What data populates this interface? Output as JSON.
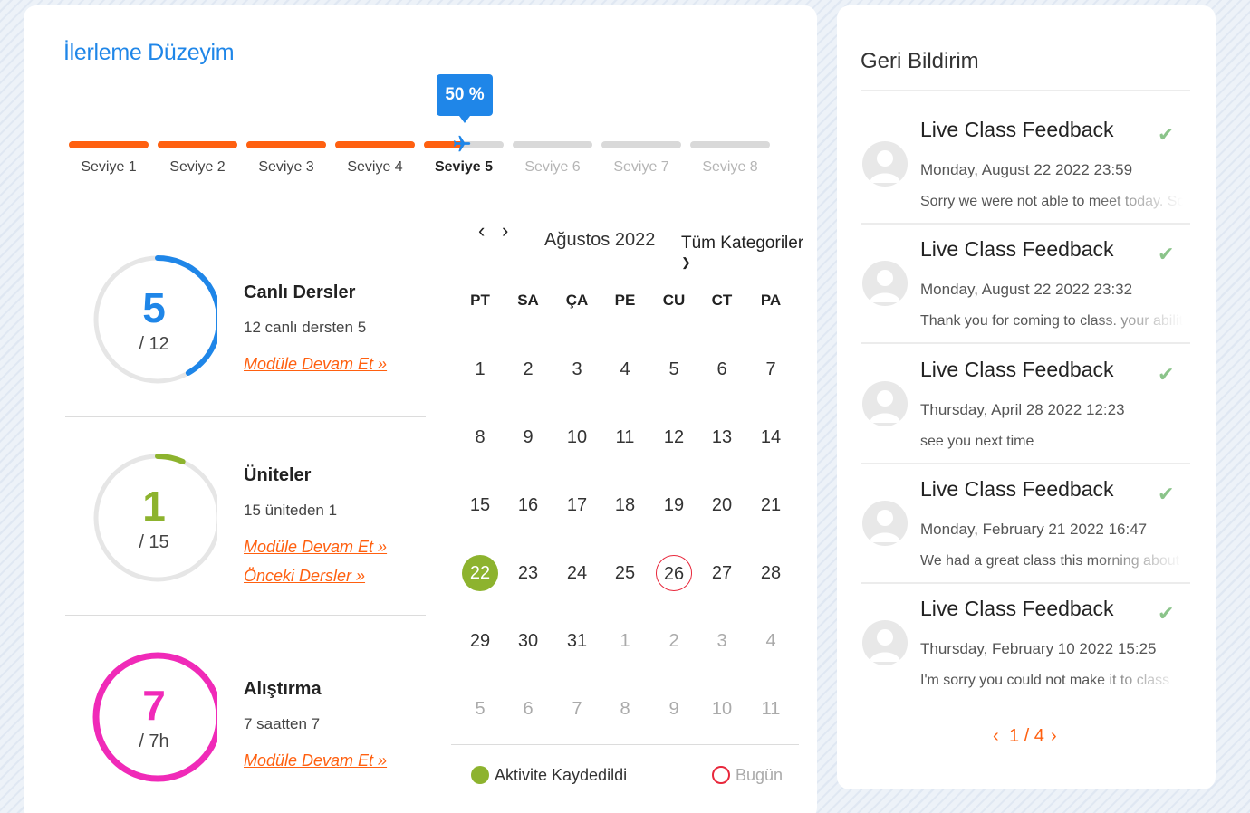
{
  "progress": {
    "title": "İlerleme Düzeyim",
    "percent_label": "50 %",
    "percent_value": 50,
    "current_level": 5,
    "levels": [
      "Seviye 1",
      "Seviye 2",
      "Seviye 3",
      "Seviye 4",
      "Seviye 5",
      "Seviye 6",
      "Seviye 7",
      "Seviye 8"
    ]
  },
  "stats": [
    {
      "number": "5",
      "total": "/ 12",
      "fraction": 0.4167,
      "color": "#1f86e8",
      "title": "Canlı Dersler",
      "desc": "12 canlı dersten 5",
      "links": [
        "Modüle Devam Et »"
      ]
    },
    {
      "number": "1",
      "total": "/ 15",
      "fraction": 0.0667,
      "color": "#8db32e",
      "title": "Üniteler",
      "desc": "15 üniteden 1",
      "links": [
        "Modüle Devam Et »",
        "Önceki Dersler »"
      ]
    },
    {
      "number": "7",
      "total": "/ 7h",
      "fraction": 1.0,
      "color": "#f02ab8",
      "title": "Alıştırma",
      "desc": "7 saatten 7",
      "links": [
        "Modüle Devam Et »"
      ]
    }
  ],
  "calendar": {
    "month": "Ağustos 2022",
    "prev": "‹",
    "next": "›",
    "category": "Tüm Kategoriler",
    "category_icon": "chevron-down",
    "weekdays": [
      "PT",
      "SA",
      "ÇA",
      "PE",
      "CU",
      "CT",
      "PA"
    ],
    "weeks": [
      [
        {
          "d": "1"
        },
        {
          "d": "2"
        },
        {
          "d": "3"
        },
        {
          "d": "4"
        },
        {
          "d": "5"
        },
        {
          "d": "6"
        },
        {
          "d": "7"
        }
      ],
      [
        {
          "d": "8"
        },
        {
          "d": "9"
        },
        {
          "d": "10"
        },
        {
          "d": "11"
        },
        {
          "d": "12"
        },
        {
          "d": "13"
        },
        {
          "d": "14"
        }
      ],
      [
        {
          "d": "15"
        },
        {
          "d": "16"
        },
        {
          "d": "17"
        },
        {
          "d": "18"
        },
        {
          "d": "19"
        },
        {
          "d": "20"
        },
        {
          "d": "21"
        }
      ],
      [
        {
          "d": "22",
          "activity": true
        },
        {
          "d": "23"
        },
        {
          "d": "24"
        },
        {
          "d": "25"
        },
        {
          "d": "26",
          "today": true
        },
        {
          "d": "27"
        },
        {
          "d": "28"
        }
      ],
      [
        {
          "d": "29"
        },
        {
          "d": "30"
        },
        {
          "d": "31"
        },
        {
          "d": "1",
          "other": true
        },
        {
          "d": "2",
          "other": true
        },
        {
          "d": "3",
          "other": true
        },
        {
          "d": "4",
          "other": true
        }
      ],
      [
        {
          "d": "5",
          "other": true
        },
        {
          "d": "6",
          "other": true
        },
        {
          "d": "7",
          "other": true
        },
        {
          "d": "8",
          "other": true
        },
        {
          "d": "9",
          "other": true
        },
        {
          "d": "10",
          "other": true
        },
        {
          "d": "11",
          "other": true
        }
      ]
    ],
    "legend_activity": "Aktivite Kaydedildi",
    "legend_today": "Bugün"
  },
  "feedback": {
    "title": "Geri Bildirim",
    "items": [
      {
        "name": "Live Class Feedback",
        "date": "Monday, August 22 2022 23:59",
        "msg": "Sorry we were not able to meet today. So"
      },
      {
        "name": "Live Class Feedback",
        "date": "Monday, August 22 2022 23:32",
        "msg": "Thank you for coming to class. your ability"
      },
      {
        "name": "Live Class Feedback",
        "date": "Thursday, April 28 2022 12:23",
        "msg": "see you next time"
      },
      {
        "name": "Live Class Feedback",
        "date": "Monday, February 21 2022 16:47",
        "msg": "We had a great class this morning about"
      },
      {
        "name": "Live Class Feedback",
        "date": "Thursday, February 10 2022 15:25",
        "msg": "I'm sorry you could not make it to class"
      }
    ],
    "pager": {
      "prev": "‹",
      "label": "1 / 4",
      "next": "›"
    }
  },
  "colors": {
    "accent": "#1f86e8",
    "orange": "#ff6010",
    "green": "#8db32e",
    "pink": "#f02ab8",
    "red": "#e8283c"
  }
}
